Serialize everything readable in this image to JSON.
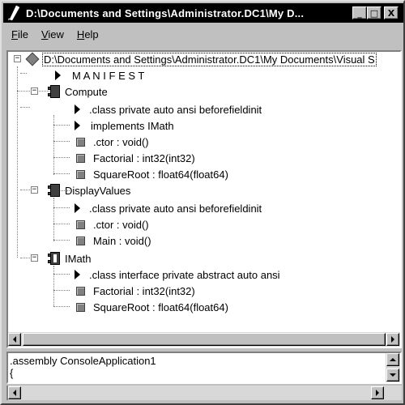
{
  "window": {
    "title": "D:\\Documents and Settings\\Administrator.DC1\\My D...",
    "minimize_label": "_",
    "maximize_label": "□",
    "close_label": "X"
  },
  "menu": {
    "file": {
      "accel": "F",
      "rest": "ile"
    },
    "view": {
      "accel": "V",
      "rest": "iew"
    },
    "help": {
      "accel": "H",
      "rest": "elp"
    }
  },
  "tree": {
    "root": {
      "label": "D:\\Documents and Settings\\Administrator.DC1\\My Documents\\Visual S",
      "icon": "assembly-diamond-icon"
    },
    "manifest": {
      "label": "M A N I F E S T",
      "icon": "triangle-icon"
    },
    "compute": {
      "label": "Compute",
      "icon": "class-icon",
      "children": [
        {
          "label": ".class private auto ansi beforefieldinit",
          "icon": "triangle-icon"
        },
        {
          "label": "implements IMath",
          "icon": "triangle-icon"
        },
        {
          "label": ".ctor : void()",
          "icon": "method-icon"
        },
        {
          "label": "Factorial : int32(int32)",
          "icon": "method-icon"
        },
        {
          "label": "SquareRoot : float64(float64)",
          "icon": "method-icon"
        }
      ]
    },
    "displayvalues": {
      "label": "DisplayValues",
      "icon": "class-icon",
      "children": [
        {
          "label": ".class private auto ansi beforefieldinit",
          "icon": "triangle-icon"
        },
        {
          "label": ".ctor : void()",
          "icon": "method-icon"
        },
        {
          "label": "Main : void()",
          "icon": "method-icon"
        }
      ]
    },
    "imath": {
      "label": "IMath",
      "icon": "interface-icon",
      "children": [
        {
          "label": ".class interface private abstract auto ansi",
          "icon": "triangle-icon"
        },
        {
          "label": "Factorial : int32(int32)",
          "icon": "method-icon"
        },
        {
          "label": "SquareRoot : float64(float64)",
          "icon": "method-icon"
        }
      ]
    },
    "expander_collapse": "−"
  },
  "code": {
    "line1": ".assembly ConsoleApplication1",
    "line2": "{"
  }
}
